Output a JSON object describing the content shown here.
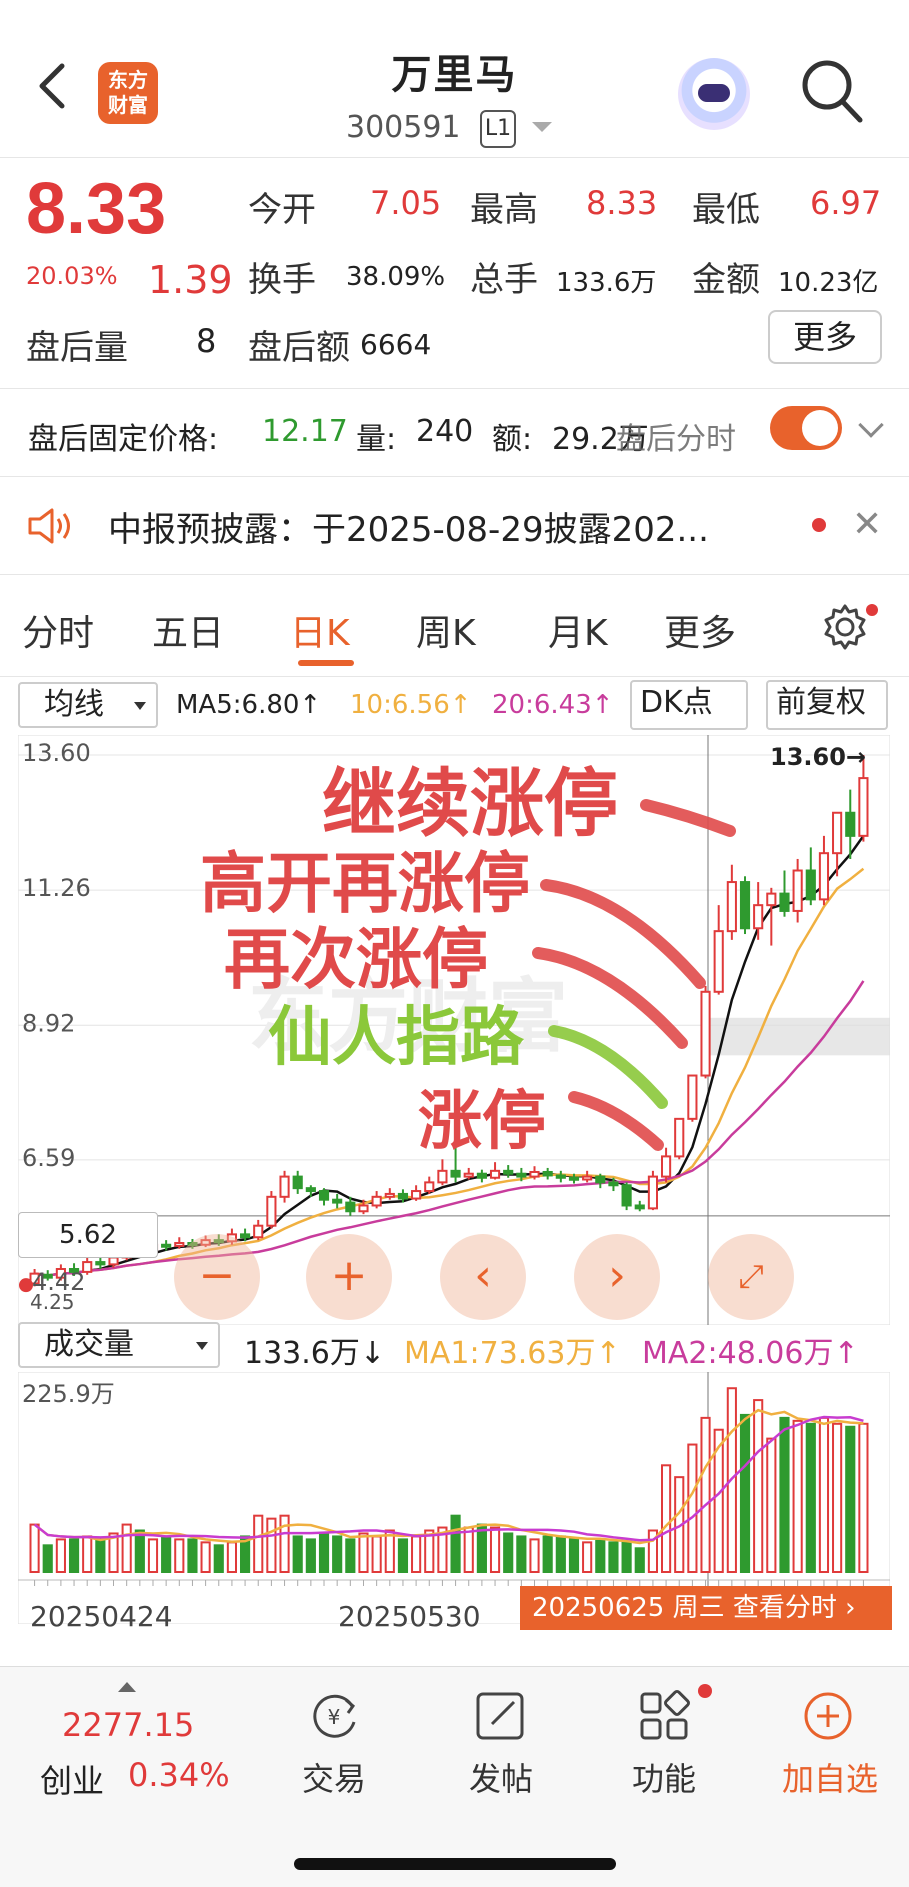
{
  "header": {
    "logo_line1": "东方",
    "logo_line2": "财富",
    "title": "万里马",
    "code": "300591",
    "level": "L1"
  },
  "quote": {
    "price": "8.33",
    "change_pct": "20.03%",
    "change": "1.39",
    "open_label": "今开",
    "open": "7.05",
    "high_label": "最高",
    "high": "8.33",
    "low_label": "最低",
    "low": "6.97",
    "turnover_label": "换手",
    "turnover": "38.09%",
    "volume_label": "总手",
    "volume": "133.6万",
    "amount_label": "金额",
    "amount": "10.23亿",
    "ah_vol_label": "盘后量",
    "ah_vol": "8",
    "ah_amt_label": "盘后额",
    "ah_amt": "6664",
    "more": "更多"
  },
  "after_hours": {
    "label": "盘后固定价格:",
    "price": "12.17",
    "qty_label": "量:",
    "qty": "240",
    "amt_label": "额:",
    "amt": "29.2万",
    "overlay": "盘后分时"
  },
  "notice": {
    "text": "中报预披露：于2025-08-29披露202..."
  },
  "tabs": [
    "分时",
    "五日",
    "日K",
    "周K",
    "月K",
    "更多"
  ],
  "ma_row": {
    "select": "均线",
    "ma5": "MA5:6.80↑",
    "ma10": "10:6.56↑",
    "ma20": "20:6.43↑",
    "dk": "DK点",
    "fq": "前复权"
  },
  "kline": {
    "y_labels": [
      "13.60",
      "11.26",
      "8.92",
      "6.59"
    ],
    "high_tag": "13.60→",
    "tag_price": "5.62",
    "low_labels": [
      "4.42",
      "4.25"
    ]
  },
  "annotations": [
    "继续涨停",
    "高开再涨停",
    "再次涨停",
    "仙人指路",
    "涨停"
  ],
  "watermark": "东方财富",
  "volume_row": {
    "select": "成交量",
    "vol": "133.6万↓",
    "ma1": "MA1:73.63万↑",
    "ma2": "MA2:48.06万↑",
    "max_label": "225.9万"
  },
  "x_labels": [
    "20250424",
    "20250530",
    "20250625"
  ],
  "date_tag": "20250625 周三 查看分时",
  "bottom": {
    "index_value": "2277.15",
    "index_name": "创业",
    "index_pct": "0.34%",
    "trade": "交易",
    "post": "发帖",
    "func": "功能",
    "add": "加自选"
  },
  "colors": {
    "up": "#e03a3a",
    "down": "#2f9a2f",
    "accent": "#e8622c",
    "ma5": "#111111",
    "ma10": "#f0b040",
    "ma20": "#c83c9c"
  },
  "chart_data": {
    "type": "candlestick",
    "y_range": [
      4.25,
      13.6
    ],
    "candles": [
      [
        4.45,
        4.62,
        4.4,
        4.7
      ],
      [
        4.6,
        4.55,
        4.5,
        4.68
      ],
      [
        4.55,
        4.7,
        4.5,
        4.78
      ],
      [
        4.7,
        4.65,
        4.58,
        4.8
      ],
      [
        4.65,
        4.82,
        4.6,
        4.9
      ],
      [
        4.82,
        4.78,
        4.7,
        4.95
      ],
      [
        4.78,
        4.9,
        4.72,
        5.0
      ],
      [
        4.9,
        5.05,
        4.85,
        5.1
      ],
      [
        5.05,
        5.0,
        4.95,
        5.12
      ],
      [
        5.0,
        5.12,
        4.95,
        5.2
      ],
      [
        5.12,
        5.1,
        5.02,
        5.2
      ],
      [
        5.1,
        5.15,
        5.05,
        5.25
      ],
      [
        5.15,
        5.12,
        5.05,
        5.22
      ],
      [
        5.12,
        5.2,
        5.08,
        5.28
      ],
      [
        5.2,
        5.18,
        5.1,
        5.3
      ],
      [
        5.18,
        5.3,
        5.12,
        5.4
      ],
      [
        5.3,
        5.25,
        5.18,
        5.4
      ],
      [
        5.25,
        5.45,
        5.2,
        5.55
      ],
      [
        5.45,
        5.95,
        5.4,
        6.05
      ],
      [
        5.95,
        6.3,
        5.85,
        6.4
      ],
      [
        6.3,
        6.1,
        6.0,
        6.4
      ],
      [
        6.1,
        6.05,
        5.95,
        6.15
      ],
      [
        6.05,
        5.9,
        5.8,
        6.1
      ],
      [
        5.9,
        5.85,
        5.75,
        6.0
      ],
      [
        5.85,
        5.7,
        5.62,
        5.95
      ],
      [
        5.7,
        5.8,
        5.65,
        5.9
      ],
      [
        5.8,
        5.95,
        5.75,
        6.05
      ],
      [
        5.95,
        6.0,
        5.9,
        6.1
      ],
      [
        6.0,
        5.92,
        5.85,
        6.08
      ],
      [
        5.92,
        6.05,
        5.88,
        6.15
      ],
      [
        6.05,
        6.2,
        6.0,
        6.3
      ],
      [
        6.2,
        6.4,
        6.15,
        6.6
      ],
      [
        6.4,
        6.3,
        6.2,
        6.8
      ],
      [
        6.3,
        6.35,
        6.25,
        6.45
      ],
      [
        6.35,
        6.28,
        6.2,
        6.42
      ],
      [
        6.28,
        6.4,
        6.25,
        6.55
      ],
      [
        6.4,
        6.35,
        6.28,
        6.5
      ],
      [
        6.35,
        6.3,
        6.22,
        6.45
      ],
      [
        6.3,
        6.38,
        6.25,
        6.48
      ],
      [
        6.38,
        6.32,
        6.25,
        6.45
      ],
      [
        6.32,
        6.28,
        6.2,
        6.4
      ],
      [
        6.28,
        6.25,
        6.18,
        6.35
      ],
      [
        6.25,
        6.3,
        6.2,
        6.4
      ],
      [
        6.3,
        6.2,
        6.1,
        6.35
      ],
      [
        6.2,
        6.15,
        6.05,
        6.28
      ],
      [
        6.15,
        5.8,
        5.72,
        6.2
      ],
      [
        5.8,
        5.75,
        5.7,
        5.88
      ],
      [
        5.75,
        6.3,
        5.72,
        6.4
      ],
      [
        6.3,
        6.65,
        6.2,
        6.8
      ],
      [
        6.65,
        7.3,
        6.6,
        7.3
      ],
      [
        7.3,
        8.05,
        7.25,
        8.05
      ],
      [
        8.05,
        9.5,
        8.0,
        9.6
      ],
      [
        9.5,
        10.55,
        9.45,
        11.0
      ],
      [
        10.55,
        11.4,
        10.4,
        11.7
      ],
      [
        11.4,
        10.6,
        10.5,
        11.5
      ],
      [
        10.6,
        11.0,
        10.4,
        11.4
      ],
      [
        11.0,
        11.2,
        10.3,
        11.3
      ],
      [
        11.2,
        10.9,
        10.8,
        11.6
      ],
      [
        10.9,
        11.6,
        10.7,
        11.8
      ],
      [
        11.6,
        11.1,
        11.0,
        12.0
      ],
      [
        11.1,
        11.9,
        11.0,
        12.2
      ],
      [
        11.9,
        12.6,
        11.5,
        12.6
      ],
      [
        12.6,
        12.2,
        11.8,
        13.0
      ],
      [
        12.2,
        13.2,
        12.1,
        13.6
      ]
    ],
    "volume": [
      160,
      90,
      110,
      110,
      120,
      110,
      130,
      160,
      140,
      110,
      120,
      110,
      110,
      100,
      90,
      100,
      120,
      190,
      180,
      190,
      120,
      110,
      130,
      120,
      110,
      130,
      120,
      140,
      110,
      120,
      140,
      150,
      190,
      150,
      160,
      150,
      130,
      120,
      110,
      120,
      120,
      110,
      100,
      110,
      100,
      100,
      80,
      140,
      360,
      320,
      430,
      520,
      480,
      620,
      530,
      580,
      450,
      520,
      510,
      500,
      520,
      500,
      490,
      500
    ],
    "ma5_from": 0,
    "price_ma_lines": "MA5/10/20",
    "volume_ma_lines": "MA1/MA2"
  }
}
